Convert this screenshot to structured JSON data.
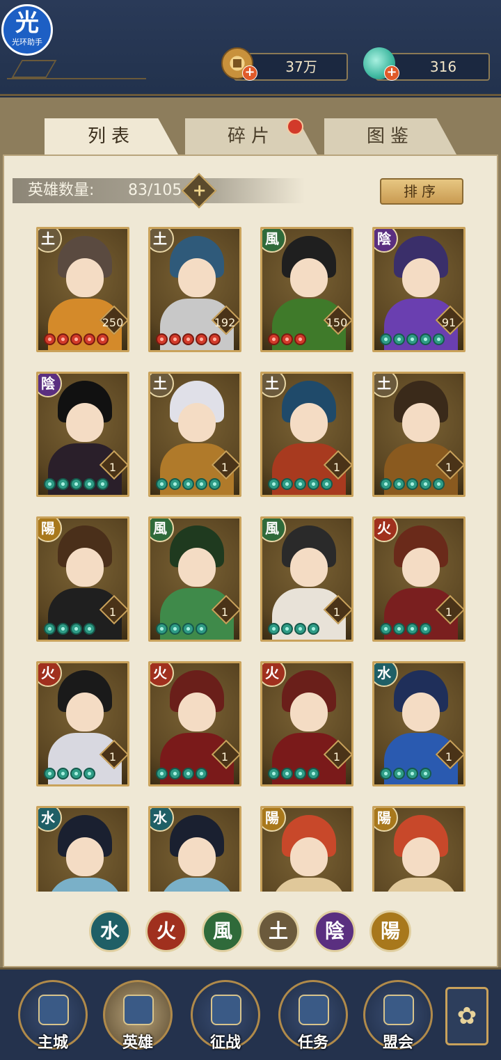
{
  "app": {
    "logo_text": "光",
    "logo_subtext": "光环助手"
  },
  "resources": {
    "coins": "37万",
    "jade": "316"
  },
  "tabs": [
    {
      "label": "列表",
      "active": true
    },
    {
      "label": "碎片",
      "active": false,
      "notification": true
    },
    {
      "label": "图鉴",
      "active": false
    }
  ],
  "hero_count": {
    "label": "英雄数量:",
    "value": "83/105"
  },
  "sort_label": "排序",
  "element_glyphs": {
    "earth": "土",
    "wind": "風",
    "yin": "陰",
    "yang": "陽",
    "fire": "火",
    "water": "水"
  },
  "heroes": [
    {
      "element": "土",
      "level": "250",
      "stars": 5,
      "star_color": "red",
      "hair": "#5a4a40",
      "body": "#d48a2a"
    },
    {
      "element": "土",
      "level": "192",
      "stars": 5,
      "star_color": "red",
      "hair": "#2f5a7a",
      "body": "#c8c8c8"
    },
    {
      "element": "風",
      "level": "150",
      "stars": 3,
      "star_color": "red",
      "hair": "#1f1f1f",
      "body": "#3f7a2a"
    },
    {
      "element": "陰",
      "level": "91",
      "stars": 5,
      "star_color": "green",
      "hair": "#3a2f6a",
      "body": "#6a3fb0"
    },
    {
      "element": "陰",
      "level": "1",
      "stars": 5,
      "star_color": "green",
      "hair": "#111111",
      "body": "#2a1f2a"
    },
    {
      "element": "土",
      "level": "1",
      "stars": 5,
      "star_color": "green",
      "hair": "#e0e0e8",
      "body": "#b07a2a"
    },
    {
      "element": "土",
      "level": "1",
      "stars": 5,
      "star_color": "green",
      "hair": "#1f4a6a",
      "body": "#a83a1f"
    },
    {
      "element": "土",
      "level": "1",
      "stars": 5,
      "star_color": "green",
      "hair": "#3a2a1a",
      "body": "#8a5a1f"
    },
    {
      "element": "陽",
      "level": "1",
      "stars": 4,
      "star_color": "green",
      "hair": "#4a2f1a",
      "body": "#1f1f1f"
    },
    {
      "element": "風",
      "level": "1",
      "stars": 4,
      "star_color": "green",
      "hair": "#1f3a1f",
      "body": "#3f8a4a"
    },
    {
      "element": "風",
      "level": "1",
      "stars": 4,
      "star_color": "green",
      "hair": "#2a2a2a",
      "body": "#e8e2d8"
    },
    {
      "element": "火",
      "level": "1",
      "stars": 4,
      "star_color": "green",
      "hair": "#6a2a1a",
      "body": "#7a1f1f"
    },
    {
      "element": "火",
      "level": "1",
      "stars": 4,
      "star_color": "green",
      "hair": "#1a1a1a",
      "body": "#d8d8e0"
    },
    {
      "element": "火",
      "level": "1",
      "stars": 4,
      "star_color": "green",
      "hair": "#6a1f1a",
      "body": "#7a1a1a"
    },
    {
      "element": "火",
      "level": "1",
      "stars": 4,
      "star_color": "green",
      "hair": "#6a1f1a",
      "body": "#7a1a1a"
    },
    {
      "element": "水",
      "level": "1",
      "stars": 4,
      "star_color": "green",
      "hair": "#1f2f5a",
      "body": "#2a5ab0"
    },
    {
      "element": "水",
      "level": "",
      "stars": 0,
      "star_color": "green",
      "hair": "#1a2030",
      "body": "#7ab0c8"
    },
    {
      "element": "水",
      "level": "",
      "stars": 0,
      "star_color": "green",
      "hair": "#1a2030",
      "body": "#7ab0c8"
    },
    {
      "element": "陽",
      "level": "",
      "stars": 0,
      "star_color": "green",
      "hair": "#c8482a",
      "body": "#e0c89a"
    },
    {
      "element": "陽",
      "level": "",
      "stars": 0,
      "star_color": "green",
      "hair": "#c8482a",
      "body": "#e0c89a"
    }
  ],
  "filters": [
    "水",
    "火",
    "風",
    "土",
    "陰",
    "陽"
  ],
  "bottom_nav": [
    "主城",
    "英雄",
    "征战",
    "任务",
    "盟会"
  ],
  "colors": {
    "accent_gold": "#c9a25b",
    "panel": "#efe8d5",
    "navy": "#24324d"
  }
}
